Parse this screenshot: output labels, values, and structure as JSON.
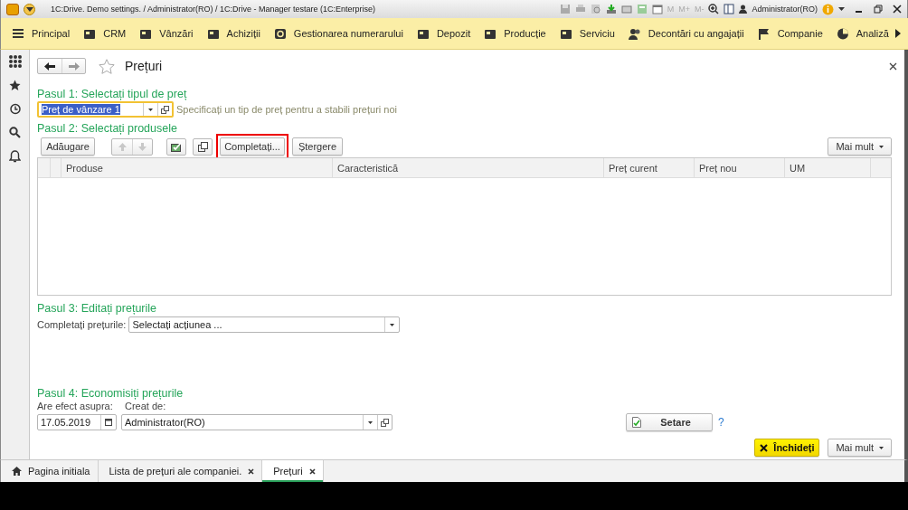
{
  "window": {
    "title": "1C:Drive. Demo settings. / Administrator(RO) / 1C:Drive  - Manager testare (1C:Enterprise)",
    "memory_buttons": [
      "M",
      "M+",
      "M-"
    ],
    "user": "Administrator(RO)"
  },
  "menu": [
    {
      "label": "Principal"
    },
    {
      "label": "CRM"
    },
    {
      "label": "Vânzări"
    },
    {
      "label": "Achiziții"
    },
    {
      "label": "Gestionarea numerarului"
    },
    {
      "label": "Depozit"
    },
    {
      "label": "Producție"
    },
    {
      "label": "Serviciu"
    },
    {
      "label": "Decontări cu angajații"
    },
    {
      "label": "Companie"
    },
    {
      "label": "Analiză"
    }
  ],
  "form": {
    "title": "Prețuri",
    "favorite": false
  },
  "step1": {
    "heading": "Pasul 1: Selectați tipul de preț",
    "price_type": {
      "value": "Preț de vânzare 1",
      "focused": true,
      "text_selected": true
    },
    "hint": "Specificați un tip de preț pentru a stabili prețuri noi"
  },
  "step2": {
    "heading": "Pasul 2: Selectați produsele",
    "add_button": {
      "label": "Adăugare",
      "highlighted": false
    },
    "move_buttons_disabled": true,
    "fill_button": {
      "label": "Completați...",
      "highlighted": true
    },
    "delete_button": {
      "label": "Ștergere",
      "highlighted": false
    },
    "more_button": "Mai mult",
    "columns": [
      "Produse",
      "Caracteristică",
      "Preț curent",
      "Preț nou",
      "UM"
    ]
  },
  "step3": {
    "heading": "Pasul 3: Editați prețurile",
    "label": "Completați prețurile:",
    "action": "Selectați acțiunea ..."
  },
  "step4": {
    "heading": "Pasul 4: Economisiți prețurile",
    "date_label": "Are efect asupra:",
    "date": "17.05.2019",
    "author_label": "Creat de:",
    "author": "Administrator(RO)",
    "setup_button": "Setare",
    "help": "?"
  },
  "footer": {
    "close_button": "Închideți",
    "more_button": "Mai mult"
  },
  "tabs": [
    {
      "label": "Pagina initiala",
      "kind": "home",
      "selected": false
    },
    {
      "label": "Lista de prețuri ale companiei.",
      "kind": "document",
      "selected": false
    },
    {
      "label": "Prețuri",
      "kind": "document",
      "selected": true
    }
  ]
}
